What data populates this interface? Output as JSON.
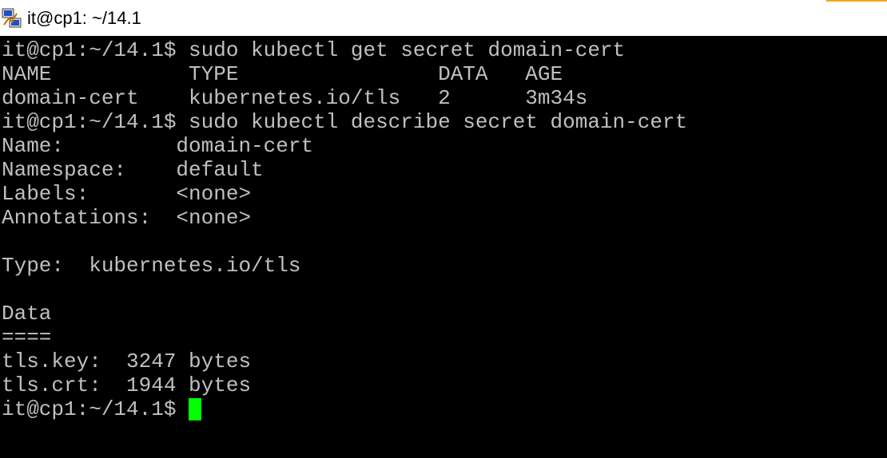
{
  "window": {
    "title": "it@cp1: ~/14.1",
    "icon": "putty-icon",
    "accent_color": "#f5a623"
  },
  "terminal": {
    "text_color": "#c0c0c0",
    "background": "#000000",
    "cursor_color": "#00ff00",
    "lines": [
      "it@cp1:~/14.1$ sudo kubectl get secret domain-cert",
      "NAME           TYPE                DATA   AGE",
      "domain-cert    kubernetes.io/tls   2      3m34s",
      "it@cp1:~/14.1$ sudo kubectl describe secret domain-cert",
      "Name:         domain-cert",
      "Namespace:    default",
      "Labels:       <none>",
      "Annotations:  <none>",
      "",
      "Type:  kubernetes.io/tls",
      "",
      "Data",
      "====",
      "tls.key:  3247 bytes",
      "tls.crt:  1944 bytes"
    ],
    "prompt": "it@cp1:~/14.1$ "
  }
}
